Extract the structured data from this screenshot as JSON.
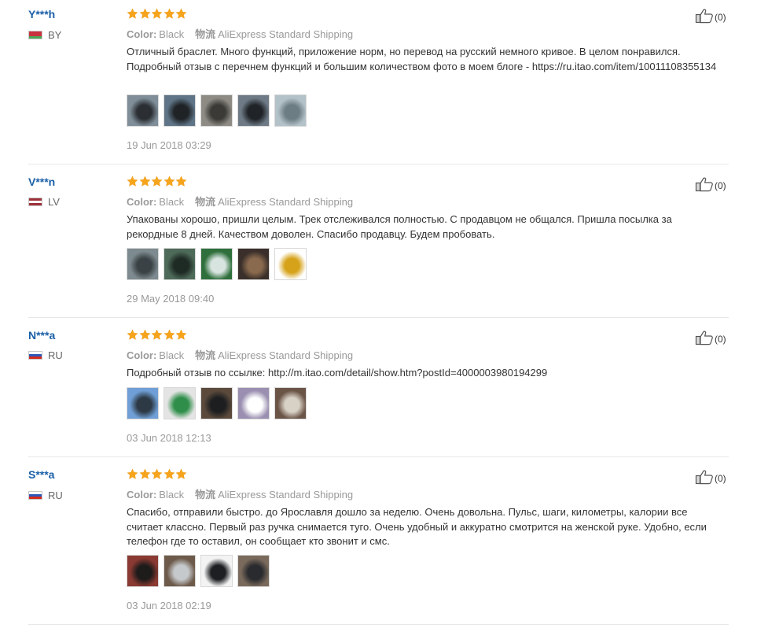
{
  "reviews": [
    {
      "user": "Y***h",
      "country": "BY",
      "flag_colors": [
        "#c8313e",
        "#c8313e",
        "#4aa657"
      ],
      "color_label": "Color:",
      "color_value": "Black",
      "shipping_label": "物流",
      "shipping_value": "AliExpress Standard Shipping",
      "text": "Отличный браслет. Много функций, приложение норм, но перевод на русский немного кривое. В целом понравился. Подробный отзыв с перечнем функций и большим количеством фото в моем блоге - https://ru.itao.com/item/10011108355134",
      "date": "19 Jun 2018 03:29",
      "likes": "(0)",
      "photos": [
        {
          "bg": "#7f8e99",
          "fg": "#2b2f33"
        },
        {
          "bg": "#5f7587",
          "fg": "#1f2326"
        },
        {
          "bg": "#8d8b84",
          "fg": "#3c3a36"
        },
        {
          "bg": "#6e7b86",
          "fg": "#202428"
        },
        {
          "bg": "#b3c2c8",
          "fg": "#6d7d84"
        }
      ]
    },
    {
      "user": "V***n",
      "country": "LV",
      "flag_colors": [
        "#9e3039",
        "#ffffff",
        "#9e3039"
      ],
      "color_label": "Color:",
      "color_value": "Black",
      "shipping_label": "物流",
      "shipping_value": "AliExpress Standard Shipping",
      "text": "Упакованы хорошо, пришли целым. Трек отслеживался полностью. С продавцом не общался. Пришла посылка за рекордные 8 дней. Качеством доволен. Спасибо продавцу. Будем пробовать.",
      "date": "29 May 2018 09:40",
      "likes": "(0)",
      "photos": [
        {
          "bg": "#7d8a8f",
          "fg": "#3a4245"
        },
        {
          "bg": "#4e6b5a",
          "fg": "#1e2a24"
        },
        {
          "bg": "#2f6f3b",
          "fg": "#d7e4e0"
        },
        {
          "bg": "#3a2f2a",
          "fg": "#8a6a4e"
        },
        {
          "bg": "#ffffff",
          "fg": "#d6a21a"
        }
      ]
    },
    {
      "user": "N***a",
      "country": "RU",
      "flag_colors": [
        "#ffffff",
        "#2b57b8",
        "#d52b1e"
      ],
      "color_label": "Color:",
      "color_value": "Black",
      "shipping_label": "物流",
      "shipping_value": "AliExpress Standard Shipping",
      "text": "Подробный отзыв по ссылке: http://m.itao.com/detail/show.htm?postId=4000003980194299",
      "date": "03 Jun 2018 12:13",
      "likes": "(0)",
      "photos": [
        {
          "bg": "#6f9fd6",
          "fg": "#2d3a46"
        },
        {
          "bg": "#e4e4e4",
          "fg": "#2f8f4a"
        },
        {
          "bg": "#5b4a3c",
          "fg": "#1c1e20"
        },
        {
          "bg": "#9a8fb0",
          "fg": "#ffffff"
        },
        {
          "bg": "#6a5446",
          "fg": "#d8d2c6"
        }
      ]
    },
    {
      "user": "S***a",
      "country": "RU",
      "flag_colors": [
        "#ffffff",
        "#2b57b8",
        "#d52b1e"
      ],
      "color_label": "Color:",
      "color_value": "Black",
      "shipping_label": "物流",
      "shipping_value": "AliExpress Standard Shipping",
      "text": "Спасибо, отправили быстро. до Ярославля дошло за неделю. Очень довольна. Пульс, шаги, километры, калории все считает классно. Первый раз ручка снимается туго. Очень удобный и аккуратно смотрится на женской руке. Удобно, если телефон где то оставил, он сообщает кто звонит и смс.",
      "date": "03 Jun 2018 02:19",
      "likes": "(0)",
      "photos": [
        {
          "bg": "#8a3a32",
          "fg": "#1e1b1b"
        },
        {
          "bg": "#6d5a4a",
          "fg": "#c6c9cc"
        },
        {
          "bg": "#f3f3f3",
          "fg": "#1d1f22"
        },
        {
          "bg": "#7a6a5c",
          "fg": "#2a2b2e"
        }
      ]
    }
  ]
}
